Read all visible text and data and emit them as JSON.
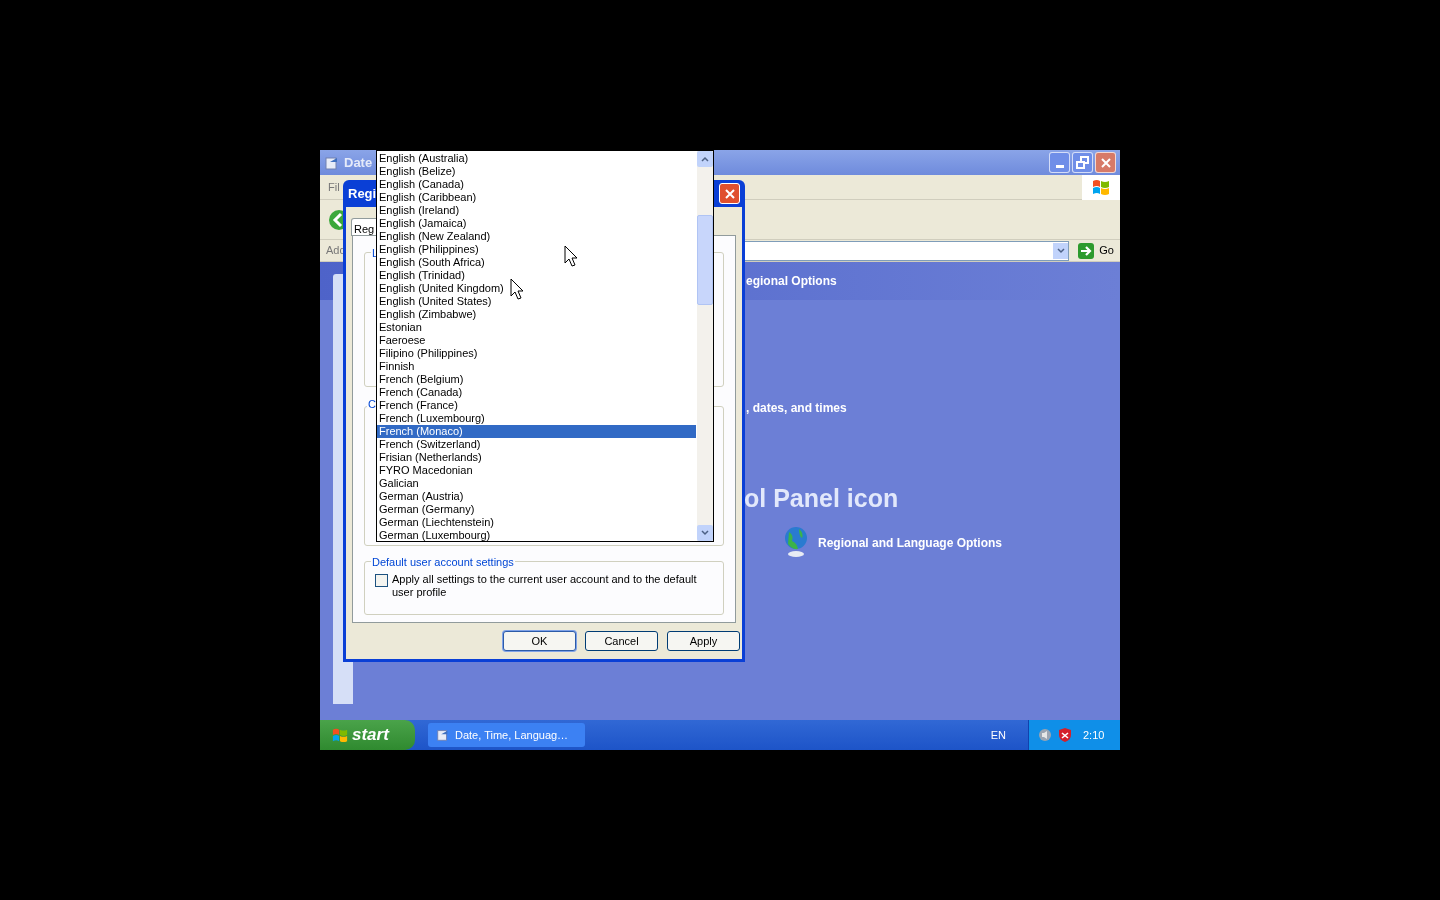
{
  "window": {
    "title": "Date",
    "menu_fragment": "Fil",
    "address_label": "Add",
    "go_button": "Go"
  },
  "content": {
    "header": "egional Options",
    "task_text": ", dates, and times",
    "heading": "ol Panel icon",
    "icon_link": "Regional and Language Options"
  },
  "dialog": {
    "title": "Regi",
    "tab": "Reg",
    "group_labels": [
      "L",
      "C"
    ],
    "dropdown": {
      "items": [
        {
          "label": "English (Australia)",
          "selected": false
        },
        {
          "label": "English (Belize)",
          "selected": false
        },
        {
          "label": "English (Canada)",
          "selected": false
        },
        {
          "label": "English (Caribbean)",
          "selected": false
        },
        {
          "label": "English (Ireland)",
          "selected": false
        },
        {
          "label": "English (Jamaica)",
          "selected": false
        },
        {
          "label": "English (New Zealand)",
          "selected": false
        },
        {
          "label": "English (Philippines)",
          "selected": false
        },
        {
          "label": "English (South Africa)",
          "selected": false
        },
        {
          "label": "English (Trinidad)",
          "selected": false
        },
        {
          "label": "English (United Kingdom)",
          "selected": false
        },
        {
          "label": "English (United States)",
          "selected": false
        },
        {
          "label": "English (Zimbabwe)",
          "selected": false
        },
        {
          "label": "Estonian",
          "selected": false
        },
        {
          "label": "Faeroese",
          "selected": false
        },
        {
          "label": "Filipino (Philippines)",
          "selected": false
        },
        {
          "label": "Finnish",
          "selected": false
        },
        {
          "label": "French (Belgium)",
          "selected": false
        },
        {
          "label": "French (Canada)",
          "selected": false
        },
        {
          "label": "French (France)",
          "selected": false
        },
        {
          "label": "French (Luxembourg)",
          "selected": false
        },
        {
          "label": "French (Monaco)",
          "selected": true
        },
        {
          "label": "French (Switzerland)",
          "selected": false
        },
        {
          "label": "Frisian (Netherlands)",
          "selected": false
        },
        {
          "label": "FYRO Macedonian",
          "selected": false
        },
        {
          "label": "Galician",
          "selected": false
        },
        {
          "label": "German (Austria)",
          "selected": false
        },
        {
          "label": "German (Germany)",
          "selected": false
        },
        {
          "label": "German (Liechtenstein)",
          "selected": false
        },
        {
          "label": "German (Luxembourg)",
          "selected": false
        }
      ]
    },
    "default_group": {
      "label": "Default user account settings",
      "checkbox": {
        "label": "Apply all settings to the current user account and to the default user profile",
        "checked": false
      }
    },
    "buttons": [
      "OK",
      "Cancel",
      "Apply"
    ]
  },
  "taskbar": {
    "start": "start",
    "tasks": [
      {
        "label": "Date, Time, Languag…"
      }
    ],
    "language": "EN",
    "clock": "2:10"
  }
}
